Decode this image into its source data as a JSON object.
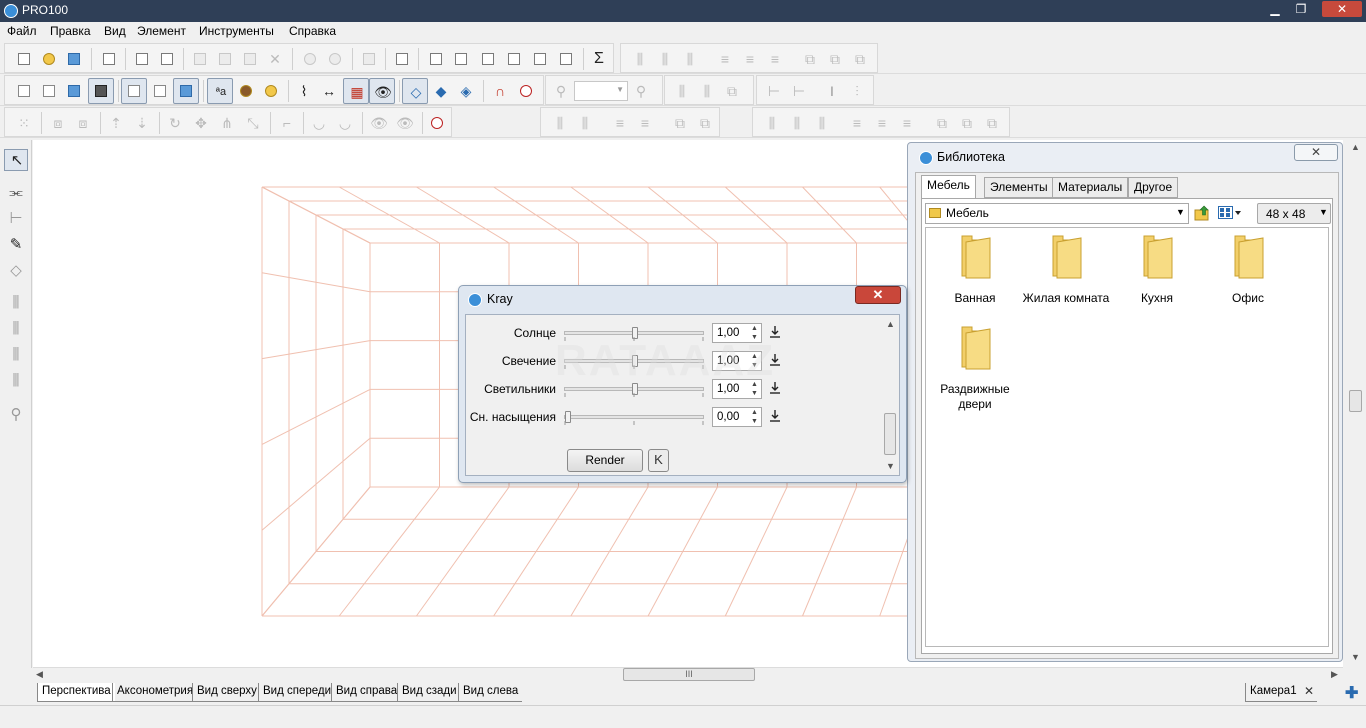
{
  "app": {
    "title": "PRO100"
  },
  "menu": [
    "Файл",
    "Правка",
    "Вид",
    "Элемент",
    "Инструменты",
    "Справка"
  ],
  "library": {
    "title": "Библиотека",
    "close_label": "✕",
    "tabs": [
      "Мебель",
      "Элементы",
      "Материалы",
      "Другое"
    ],
    "category": "Мебель",
    "icon_size": "48 x  48",
    "items": [
      "Ванная",
      "Жилая комната",
      "Кухня",
      "Офис",
      "Раздвижные двери"
    ]
  },
  "kray": {
    "title": "Kray",
    "close_label": "✕",
    "rows": [
      {
        "label": "Солнце",
        "value": "1,00",
        "level": 0.5
      },
      {
        "label": "Свечение",
        "value": "1,00",
        "level": 0.5
      },
      {
        "label": "Светильники",
        "value": "1,00",
        "level": 0.5
      },
      {
        "label": "Сн. насыщения",
        "value": "0,00",
        "level": 0.0
      }
    ],
    "render_label": "Render",
    "collapse_label": "K"
  },
  "view_tabs": [
    "Перспектива",
    "Аксонометрия",
    "Вид сверху",
    "Вид спереди",
    "Вид справа",
    "Вид сзади",
    "Вид слева"
  ],
  "camera_tab": "Камера1",
  "scroll_grip": "III",
  "watermark": "RATAAAZ",
  "colors": {
    "grid": "#f0c0b0",
    "accent": "#3b8fd8",
    "titlebar": "#2f3f57",
    "close": "#c9473a"
  }
}
